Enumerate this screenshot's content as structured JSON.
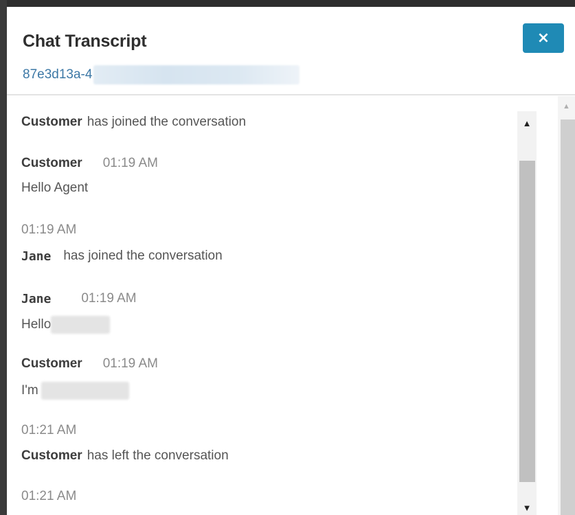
{
  "modal": {
    "title": "Chat Transcript",
    "contact_id_visible": "87e3d13a-4",
    "close_label": "×"
  },
  "transcript": {
    "m1": {
      "name": "Customer",
      "text": "has joined the conversation"
    },
    "m2": {
      "name": "Customer",
      "time": "01:19 AM",
      "text": "Hello Agent"
    },
    "m3": {
      "time": "01:19 AM",
      "name": "Jane",
      "text": "has joined the conversation"
    },
    "m4": {
      "name": "Jane",
      "time": "01:19 AM",
      "text": "Hello"
    },
    "m5": {
      "name": "Customer",
      "time": "01:19 AM",
      "text": "I'm"
    },
    "m6": {
      "time": "01:21 AM",
      "name": "Customer",
      "text": "has left the conversation"
    },
    "m7": {
      "time": "01:21 AM"
    }
  },
  "icons": {
    "close": "close-icon",
    "scroll_up": "chevron-up-icon",
    "scroll_down": "chevron-down-icon"
  },
  "colors": {
    "close_button": "#1f8ab5",
    "contact_id_link": "#3c78a6",
    "title_text": "#2f2f2f",
    "timestamp_text": "#8a8a8a"
  }
}
